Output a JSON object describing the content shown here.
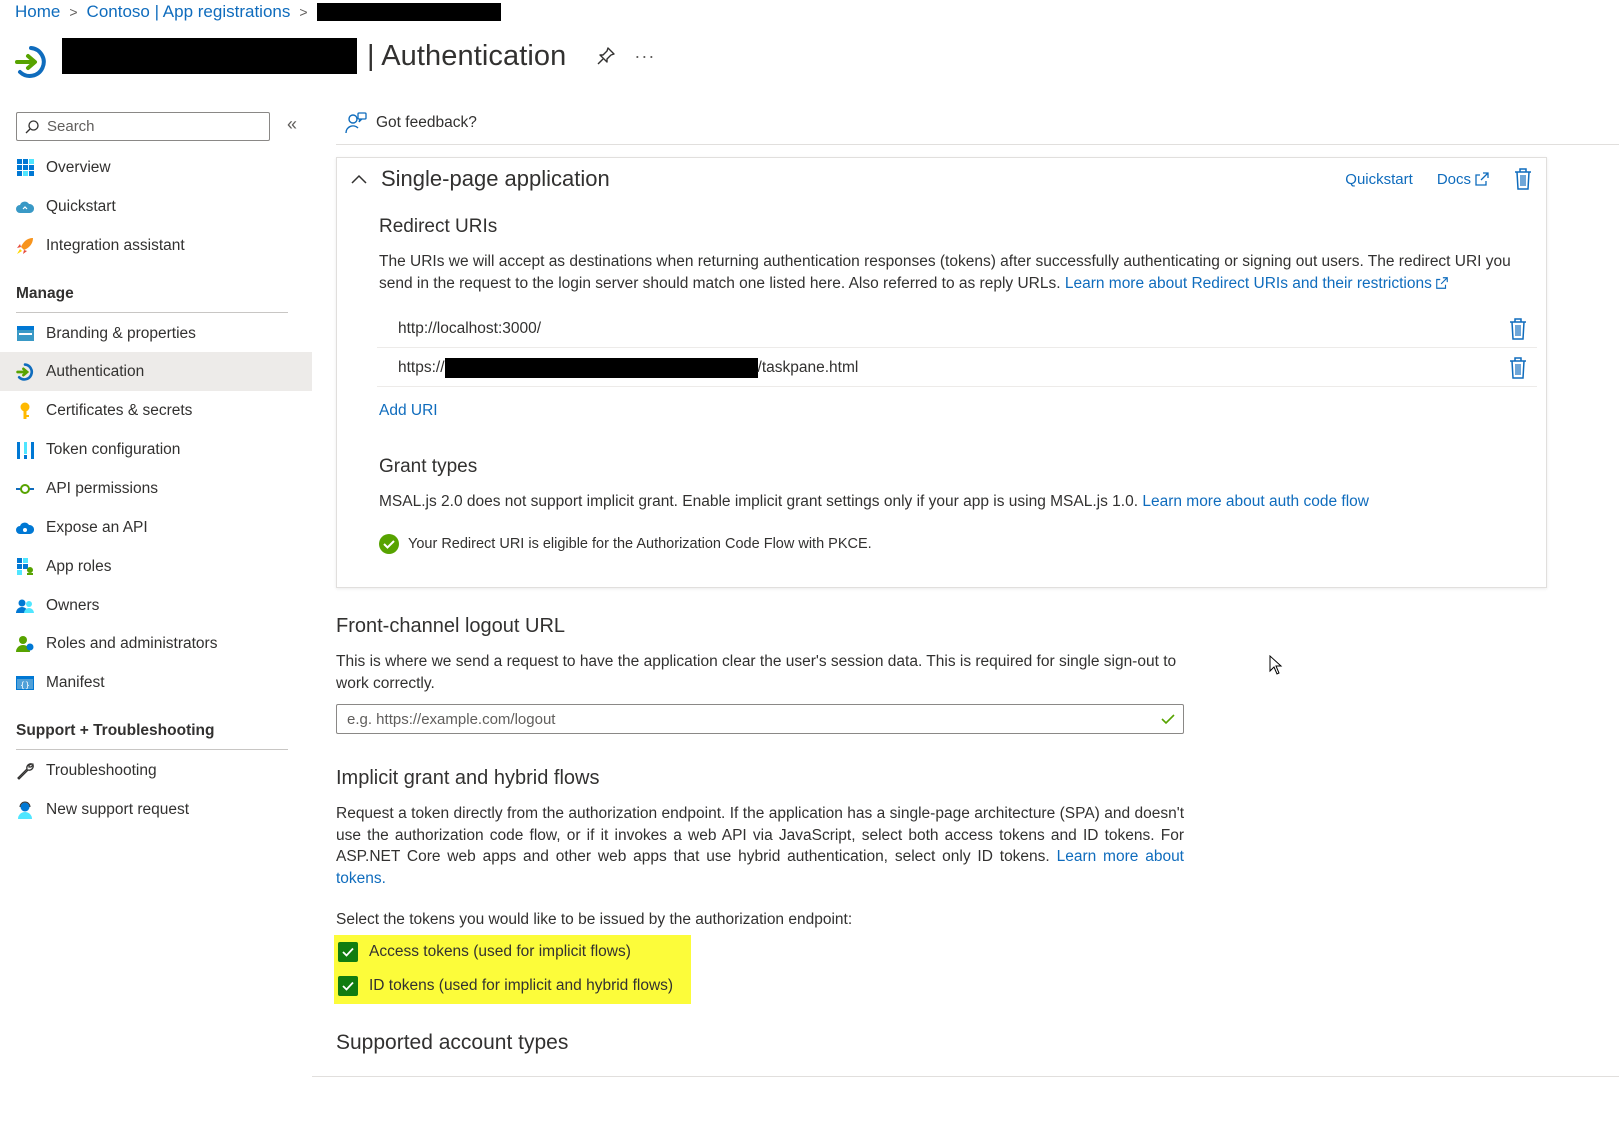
{
  "breadcrumb": {
    "home": "Home",
    "tenant": "Contoso | App registrations",
    "sep": ">"
  },
  "header": {
    "title": "| Authentication",
    "more": "···"
  },
  "sidebar": {
    "search_placeholder": "Search",
    "collapse": "«",
    "top_items": [
      {
        "label": "Overview",
        "icon": "overview-grid-icon"
      },
      {
        "label": "Quickstart",
        "icon": "cloud-quickstart-icon"
      },
      {
        "label": "Integration assistant",
        "icon": "rocket-icon"
      }
    ],
    "manage_heading": "Manage",
    "manage_items": [
      {
        "label": "Branding & properties",
        "icon": "branding-icon"
      },
      {
        "label": "Authentication",
        "icon": "authentication-icon",
        "active": true
      },
      {
        "label": "Certificates & secrets",
        "icon": "key-icon"
      },
      {
        "label": "Token configuration",
        "icon": "token-bars-icon"
      },
      {
        "label": "API permissions",
        "icon": "api-permissions-icon"
      },
      {
        "label": "Expose an API",
        "icon": "cloud-api-icon"
      },
      {
        "label": "App roles",
        "icon": "app-roles-icon"
      },
      {
        "label": "Owners",
        "icon": "owners-icon"
      },
      {
        "label": "Roles and administrators",
        "icon": "roles-admin-icon"
      },
      {
        "label": "Manifest",
        "icon": "manifest-icon"
      }
    ],
    "support_heading": "Support + Troubleshooting",
    "support_items": [
      {
        "label": "Troubleshooting",
        "icon": "wrench-icon"
      },
      {
        "label": "New support request",
        "icon": "support-person-icon"
      }
    ]
  },
  "feedback": {
    "label": "Got feedback?"
  },
  "spa_card": {
    "title": "Single-page application",
    "quickstart_link": "Quickstart",
    "docs_link": "Docs",
    "redirect_heading": "Redirect URIs",
    "redirect_desc": "The URIs we will accept as destinations when returning authentication responses (tokens) after successfully authenticating or signing out users. The redirect URI you send in the request to the login server should match one listed here. Also referred to as reply URLs.",
    "redirect_learn_more": "Learn more about Redirect URIs and their restrictions",
    "uris": [
      {
        "prefix": "http://localhost:3000/",
        "suffix": ""
      },
      {
        "prefix": "https://",
        "suffix": "/taskpane.html"
      }
    ],
    "add_uri": "Add URI",
    "grant_heading": "Grant types",
    "grant_desc": "MSAL.js 2.0 does not support implicit grant. Enable implicit grant settings only if your app is using MSAL.js 1.0.",
    "grant_learn_more": "Learn more about auth code flow",
    "eligible_msg": "Your Redirect URI is eligible for the Authorization Code Flow with PKCE."
  },
  "front_channel": {
    "title": "Front-channel logout URL",
    "desc": "This is where we send a request to have the application clear the user's session data. This is required for single sign-out to work correctly.",
    "placeholder": "e.g. https://example.com/logout"
  },
  "implicit": {
    "title": "Implicit grant and hybrid flows",
    "desc": "Request a token directly from the authorization endpoint. If the application has a single-page architecture (SPA) and doesn't use the authorization code flow, or if it invokes a web API via JavaScript, select both access tokens and ID tokens. For ASP.NET Core web apps and other web apps that use hybrid authentication, select only ID tokens.",
    "learn_more": "Learn more about tokens.",
    "select_prompt": "Select the tokens you would like to be issued by the authorization endpoint:",
    "access_tokens": {
      "label": "Access tokens (used for implicit flows)",
      "checked": true
    },
    "id_tokens": {
      "label": "ID tokens (used for implicit and hybrid flows)",
      "checked": true
    },
    "highlight_color": "#fcfc3a"
  },
  "supported": {
    "title": "Supported account types"
  },
  "colors": {
    "accent": "#0f6cbd",
    "success": "#107c10",
    "active_nav": "#edebe9"
  }
}
